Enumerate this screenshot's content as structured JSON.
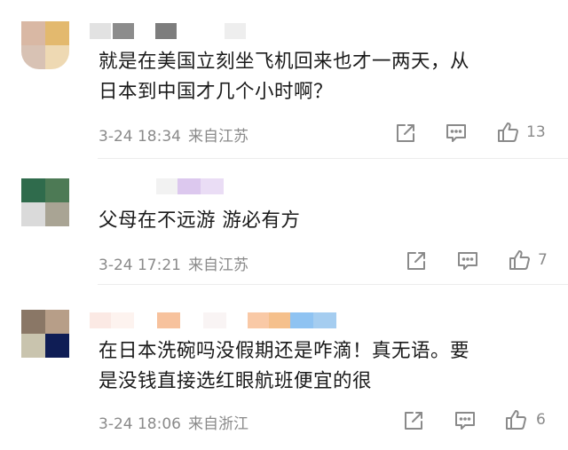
{
  "comments": [
    {
      "text_lines": [
        "就是在美国立刻坐飞机回来也才一两天，从",
        "日本到中国才几个小时啊？"
      ],
      "time": "3-24 18:34",
      "location": "来自江苏",
      "likes": "13"
    },
    {
      "text_lines": [
        "父母在不远游  游必有方"
      ],
      "time": "3-24 17:21",
      "location": "来自江苏",
      "likes": "7"
    },
    {
      "text_lines": [
        "在日本洗碗吗没假期还是咋滴！真无语。要",
        "是没钱直接选红眼航班便宜的很"
      ],
      "time": "3-24 18:06",
      "location": "来自浙江",
      "likes": "6"
    }
  ],
  "icons": {
    "share": "share-icon",
    "reply": "comment-icon",
    "like": "thumbs-up-icon"
  },
  "colors": {
    "text": "#1a1a1a",
    "meta": "#8a8a8a",
    "icon": "#8a8a8a",
    "divider": "#ececec"
  }
}
